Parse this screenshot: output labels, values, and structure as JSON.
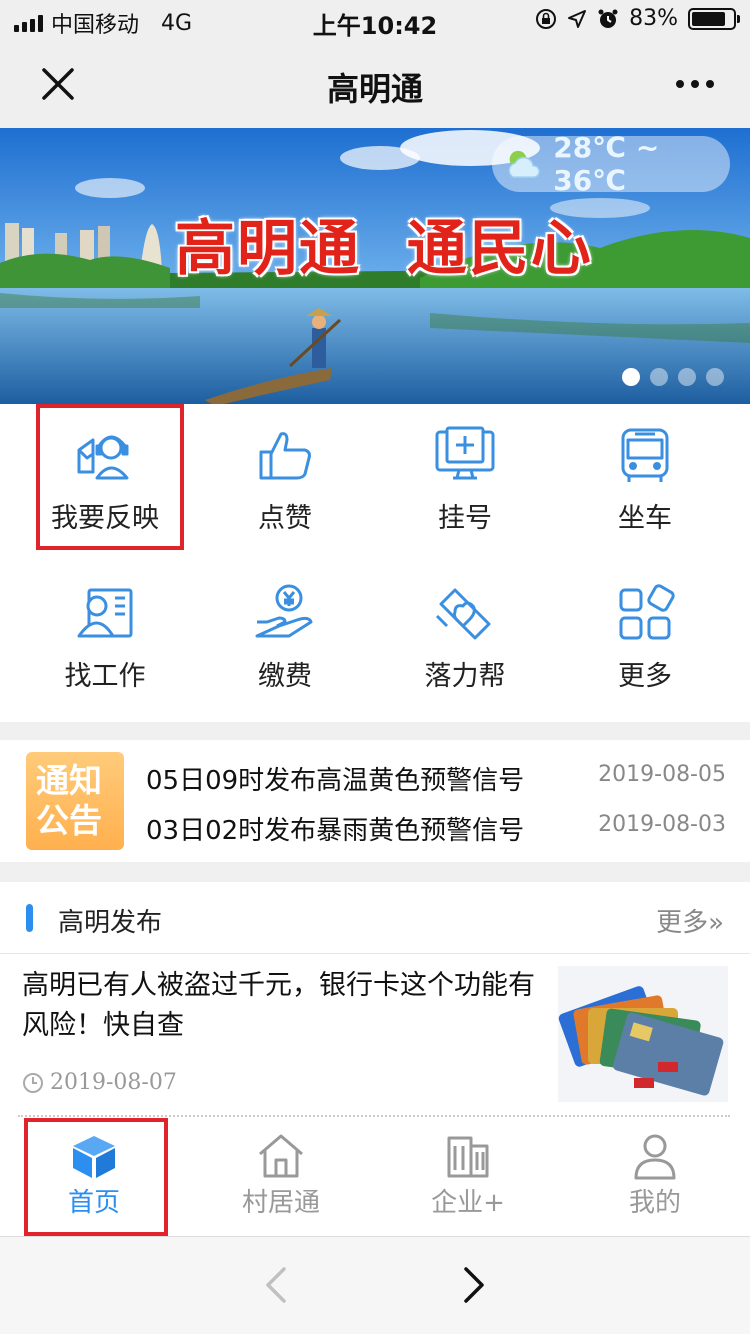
{
  "status_bar": {
    "carrier": "中国移动",
    "network": "4G",
    "time": "上午10:42",
    "battery_percent_text": "83%",
    "battery_level": 0.83
  },
  "nav": {
    "title": "高明通"
  },
  "banner": {
    "temperature": "28℃ ~ 36℃",
    "slogan": "高明通  通民心",
    "slides": 4,
    "active_slide": 1
  },
  "services": [
    {
      "label": "我要反映",
      "icon": "feedback-agent-icon",
      "highlighted": true
    },
    {
      "label": "点赞",
      "icon": "thumbs-up-icon"
    },
    {
      "label": "挂号",
      "icon": "medical-register-icon"
    },
    {
      "label": "坐车",
      "icon": "bus-icon"
    },
    {
      "label": "找工作",
      "icon": "job-profile-icon"
    },
    {
      "label": "缴费",
      "icon": "payment-yuan-icon"
    },
    {
      "label": "落力帮",
      "icon": "heart-help-icon"
    },
    {
      "label": "更多",
      "icon": "more-apps-icon"
    }
  ],
  "notice": {
    "badge_line1": "通知",
    "badge_line2": "公告",
    "items": [
      {
        "title": "05日09时发布高温黄色预警信号",
        "date": "2019-08-05"
      },
      {
        "title": "03日02时发布暴雨黄色预警信号",
        "date": "2019-08-03"
      }
    ]
  },
  "section": {
    "name": "高明发布",
    "more": "更多»",
    "article": {
      "title": "高明已有人被盗过千元，银行卡这个功能有风险！快自查",
      "date": "2019-08-07"
    }
  },
  "tabs": [
    {
      "label": "首页",
      "icon": "home-box-icon",
      "active": true
    },
    {
      "label": "村居通",
      "icon": "house-icon"
    },
    {
      "label": "企业+",
      "icon": "building-icon"
    },
    {
      "label": "我的",
      "icon": "user-icon"
    }
  ],
  "colors": {
    "accent": "#2c8ff0",
    "icon_blue": "#3a8fe0",
    "highlight_red": "#e0242c",
    "slogan_red": "#e2231a",
    "notice_badge": "#ffb04e"
  }
}
